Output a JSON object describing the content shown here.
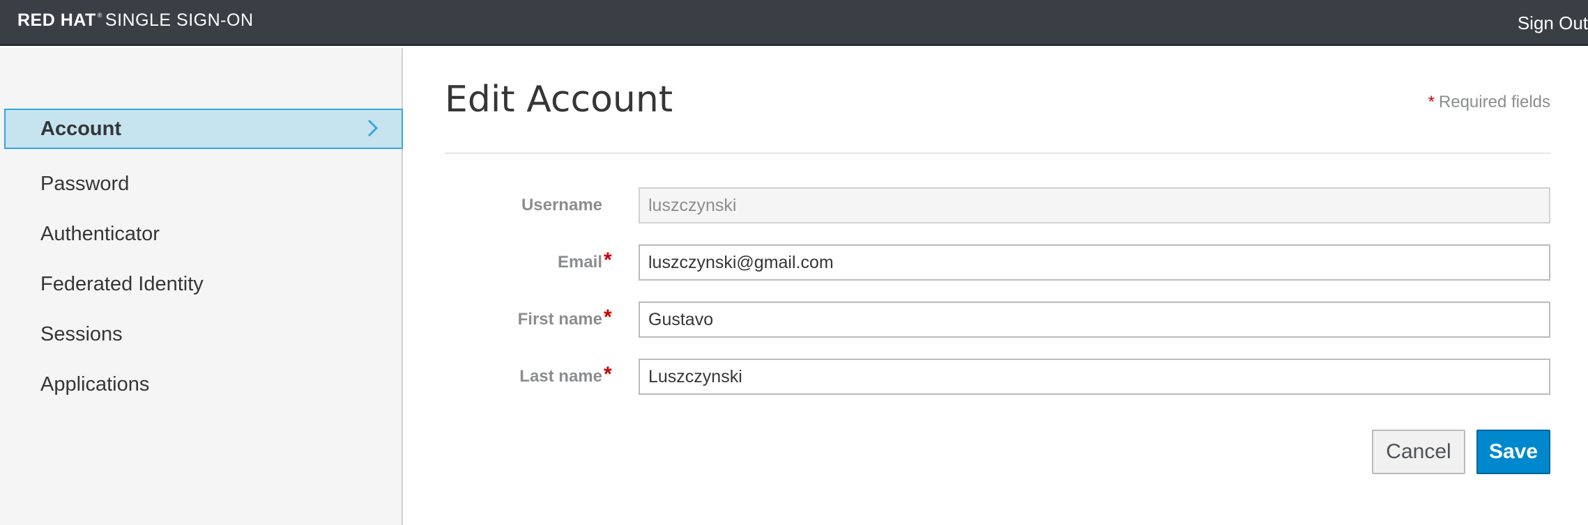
{
  "header": {
    "brand_bold": "RED HAT",
    "brand_tm": "®",
    "brand_rest": "SINGLE SIGN-ON",
    "sign_out": "Sign Out"
  },
  "sidebar": {
    "items": [
      {
        "label": "Account",
        "active": true
      },
      {
        "label": "Password"
      },
      {
        "label": "Authenticator"
      },
      {
        "label": "Federated Identity"
      },
      {
        "label": "Sessions"
      },
      {
        "label": "Applications"
      }
    ]
  },
  "main": {
    "title": "Edit Account",
    "required_star": "*",
    "required_text": "Required fields",
    "fields": {
      "username": {
        "label": "Username",
        "value": "luszczynski"
      },
      "email": {
        "label": "Email",
        "value": "luszczynski@gmail.com"
      },
      "first_name": {
        "label": "First name",
        "value": "Gustavo"
      },
      "last_name": {
        "label": "Last name",
        "value": "Luszczynski"
      }
    },
    "cancel_label": "Cancel",
    "save_label": "Save"
  },
  "colors": {
    "topbar": "#393f44",
    "active_bg": "#c5e4f0",
    "active_border": "#39a5dc",
    "primary": "#0088ce",
    "required": "#cc0000"
  }
}
